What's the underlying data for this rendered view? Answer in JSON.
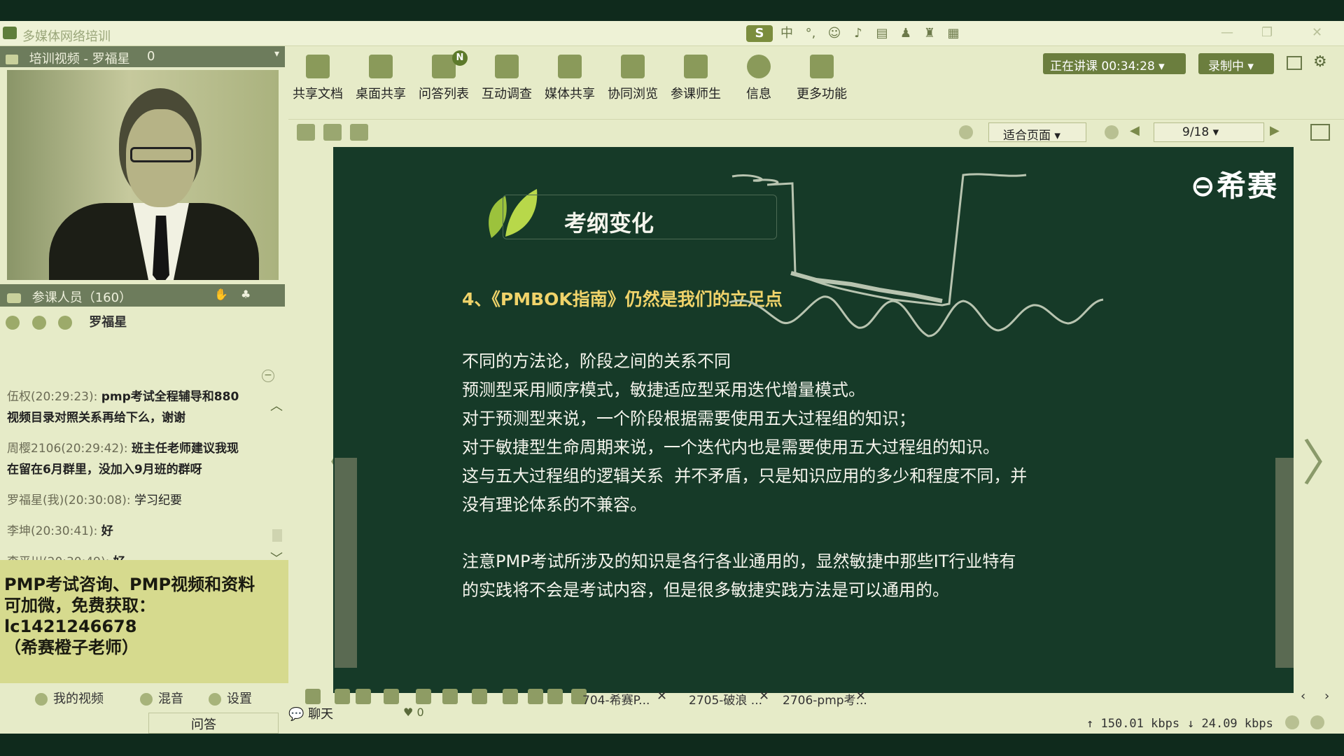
{
  "window": {
    "title": "多媒体网络培训",
    "ime_label": "中",
    "ime_symbol": "°,"
  },
  "video_panel": {
    "header": "培训视频 - 罗福星",
    "viewer_count": "0"
  },
  "participants": {
    "label": "参课人员（160）",
    "presenter_name": "罗福星"
  },
  "chat": {
    "messages": [
      {
        "who": "伍权(20:29:23):",
        "text": "pmp考试全程辅导和880",
        "cont": "视频目录对照关系再给下么，谢谢"
      },
      {
        "who": "周樱2106(20:29:42):",
        "text": "班主任老师建议我现",
        "cont": "在留在6月群里，没加入9月班的群呀"
      },
      {
        "who": "罗福星(我)(20:30:08):",
        "text": "学习纪要"
      },
      {
        "who": "李坤(20:30:41):",
        "text": "好"
      },
      {
        "who": "李平川(20:30:49):",
        "text": "好"
      }
    ]
  },
  "promo": {
    "lines": [
      "PMP考试咨询、PMP视频和资料",
      "可加微，免费获取：",
      "lc1421246678",
      "（希赛橙子老师）"
    ]
  },
  "left_bottom": {
    "my_video": "我的视频",
    "mix": "混音",
    "settings": "设置",
    "qa": "问答",
    "chat": "聊天",
    "likes": "0"
  },
  "toolbar": {
    "items": [
      "共享文档",
      "桌面共享",
      "问答列表",
      "互动调查",
      "媒体共享",
      "协同浏览",
      "参课师生",
      "信息",
      "更多功能"
    ],
    "badge": "N",
    "status": "正在讲课 00:34:28",
    "record": "录制中"
  },
  "navbar": {
    "zoom": "适合页面",
    "page": "9/18"
  },
  "slide": {
    "brand": "希赛",
    "title": "考纲变化",
    "heading": "4、《PMBOK指南》仍然是我们的立足点",
    "paragraphs": [
      "不同的方法论，阶段之间的关系不同",
      "预测型采用顺序模式，敏捷适应型采用迭代增量模式。",
      "对于预测型来说，一个阶段根据需要使用五大过程组的知识；",
      "对于敏捷型生命周期来说，一个迭代内也是需要使用五大过程组的知识。",
      "这与五大过程组的逻辑关系  并不矛盾，只是知识应用的多少和程度不同，并",
      "没有理论体系的不兼容。",
      "注意PMP考试所涉及的知识是各行各业通用的，显然敏捷中那些IT行业特有",
      "的实践将不会是考试内容，但是很多敏捷实践方法是可以通用的。"
    ]
  },
  "file_tabs": [
    "704-希赛P...",
    "2705-破浪 ...",
    "2706-pmp考..."
  ],
  "status": {
    "upload": "150.01 kbps",
    "download": "24.09 kbps"
  }
}
